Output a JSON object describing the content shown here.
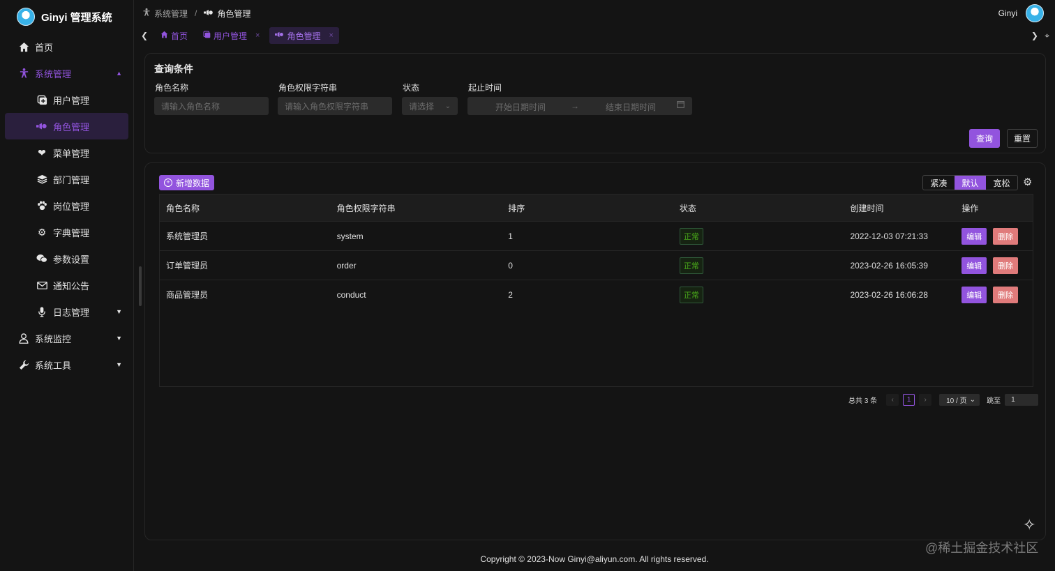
{
  "app": {
    "title": "Ginyi 管理系统"
  },
  "sidebar": {
    "items": [
      {
        "label": "首页",
        "icon": "home-icon"
      },
      {
        "label": "系统管理",
        "icon": "person-icon"
      },
      {
        "label": "用户管理",
        "icon": "user-square-icon"
      },
      {
        "label": "角色管理",
        "icon": "role-icon"
      },
      {
        "label": "菜单管理",
        "icon": "heart-icon"
      },
      {
        "label": "部门管理",
        "icon": "layers-icon"
      },
      {
        "label": "岗位管理",
        "icon": "paw-icon"
      },
      {
        "label": "字典管理",
        "icon": "gear-icon"
      },
      {
        "label": "参数设置",
        "icon": "chat-icon"
      },
      {
        "label": "通知公告",
        "icon": "mail-icon"
      },
      {
        "label": "日志管理",
        "icon": "mic-icon"
      },
      {
        "label": "系统监控",
        "icon": "person-outline-icon"
      },
      {
        "label": "系统工具",
        "icon": "wrench-icon"
      }
    ]
  },
  "header": {
    "breadcrumb": [
      "系统管理",
      "/",
      "角色管理"
    ],
    "username": "Ginyi"
  },
  "tabs": [
    {
      "label": "首页"
    },
    {
      "label": "用户管理",
      "close": "×"
    },
    {
      "label": "角色管理",
      "close": "×"
    }
  ],
  "query": {
    "title": "查询条件",
    "role_name_label": "角色名称",
    "role_name_placeholder": "请输入角色名称",
    "role_key_label": "角色权限字符串",
    "role_key_placeholder": "请输入角色权限字符串",
    "status_label": "状态",
    "status_placeholder": "请选择",
    "time_label": "起止时间",
    "start_placeholder": "开始日期时间",
    "arrow": "→",
    "end_placeholder": "结束日期时间",
    "search_button": "查询",
    "reset_button": "重置"
  },
  "toolbar": {
    "add_button": "新增数据",
    "density": [
      "紧凑",
      "默认",
      "宽松"
    ]
  },
  "table": {
    "columns": [
      "角色名称",
      "角色权限字符串",
      "排序",
      "状态",
      "创建时间",
      "操作"
    ],
    "rows": [
      {
        "name": "系统管理员",
        "key": "system",
        "sort": "1",
        "status": "正常",
        "created": "2022-12-03 07:21:33",
        "edit": "编辑",
        "delete": "删除"
      },
      {
        "name": "订单管理员",
        "key": "order",
        "sort": "0",
        "status": "正常",
        "created": "2023-02-26 16:05:39",
        "edit": "编辑",
        "delete": "删除"
      },
      {
        "name": "商品管理员",
        "key": "conduct",
        "sort": "2",
        "status": "正常",
        "created": "2023-02-26 16:06:28",
        "edit": "编辑",
        "delete": "删除"
      }
    ]
  },
  "pagination": {
    "total": "总共 3 条",
    "current_page": "1",
    "page_size": "10 / 页",
    "jump_label": "跳至",
    "jump_value": "1"
  },
  "footer": {
    "copyright": "Copyright © 2023-Now Ginyi@aliyun.com. All rights reserved."
  },
  "watermark": "@稀土掘金技术社区",
  "colors": {
    "accent": "#9254de",
    "danger": "#e07b7b",
    "success": "#49aa19",
    "background": "#141414"
  }
}
